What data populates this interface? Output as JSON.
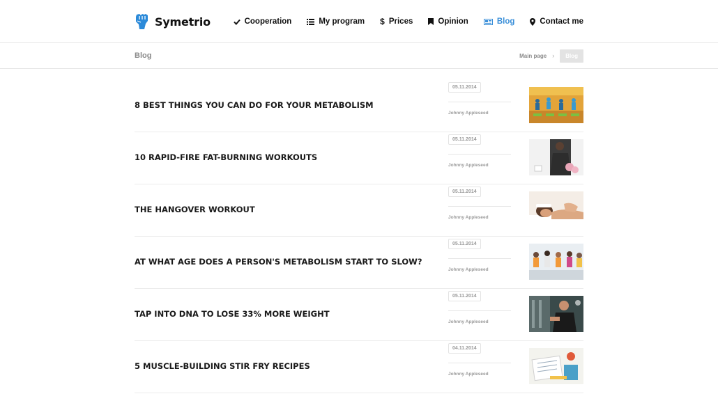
{
  "brand": {
    "name": "Symetrio",
    "color": "#2b8ad9"
  },
  "nav": [
    {
      "label": "Cooperation",
      "icon": "check-icon"
    },
    {
      "label": "My program",
      "icon": "list-icon"
    },
    {
      "label": "Prices",
      "icon": "dollar-icon"
    },
    {
      "label": "Opinion",
      "icon": "bookmark-icon"
    },
    {
      "label": "Blog",
      "icon": "newspaper-icon",
      "active": true
    },
    {
      "label": "Contact me",
      "icon": "map-marker-icon"
    }
  ],
  "page": {
    "title": "Blog"
  },
  "breadcrumb": {
    "home": "Main page",
    "current": "Blog"
  },
  "posts": [
    {
      "title": "8 BEST THINGS YOU CAN DO FOR YOUR METABOLISM",
      "date": "05.11.2014",
      "author": "Johnny Appleseed",
      "image": "fitness-class-photo"
    },
    {
      "title": "10 RAPID-FIRE FAT-BURNING WORKOUTS",
      "date": "05.11.2014",
      "author": "Johnny Appleseed",
      "image": "kettlebell-workout-photo"
    },
    {
      "title": "THE HANGOVER WORKOUT",
      "date": "05.11.2014",
      "author": "Johnny Appleseed",
      "image": "massage-photo"
    },
    {
      "title": "AT WHAT AGE DOES A PERSON'S METABOLISM START TO SLOW?",
      "date": "05.11.2014",
      "author": "Johnny Appleseed",
      "image": "gym-group-photo"
    },
    {
      "title": "TAP INTO DNA TO LOSE 33% MORE WEIGHT",
      "date": "05.11.2014",
      "author": "Johnny Appleseed",
      "image": "gym-machine-photo"
    },
    {
      "title": "5 MUSCLE-BUILDING STIR FRY RECIPES",
      "date": "04.11.2014",
      "author": "Johnny Appleseed",
      "image": "nutrition-plan-photo"
    }
  ]
}
